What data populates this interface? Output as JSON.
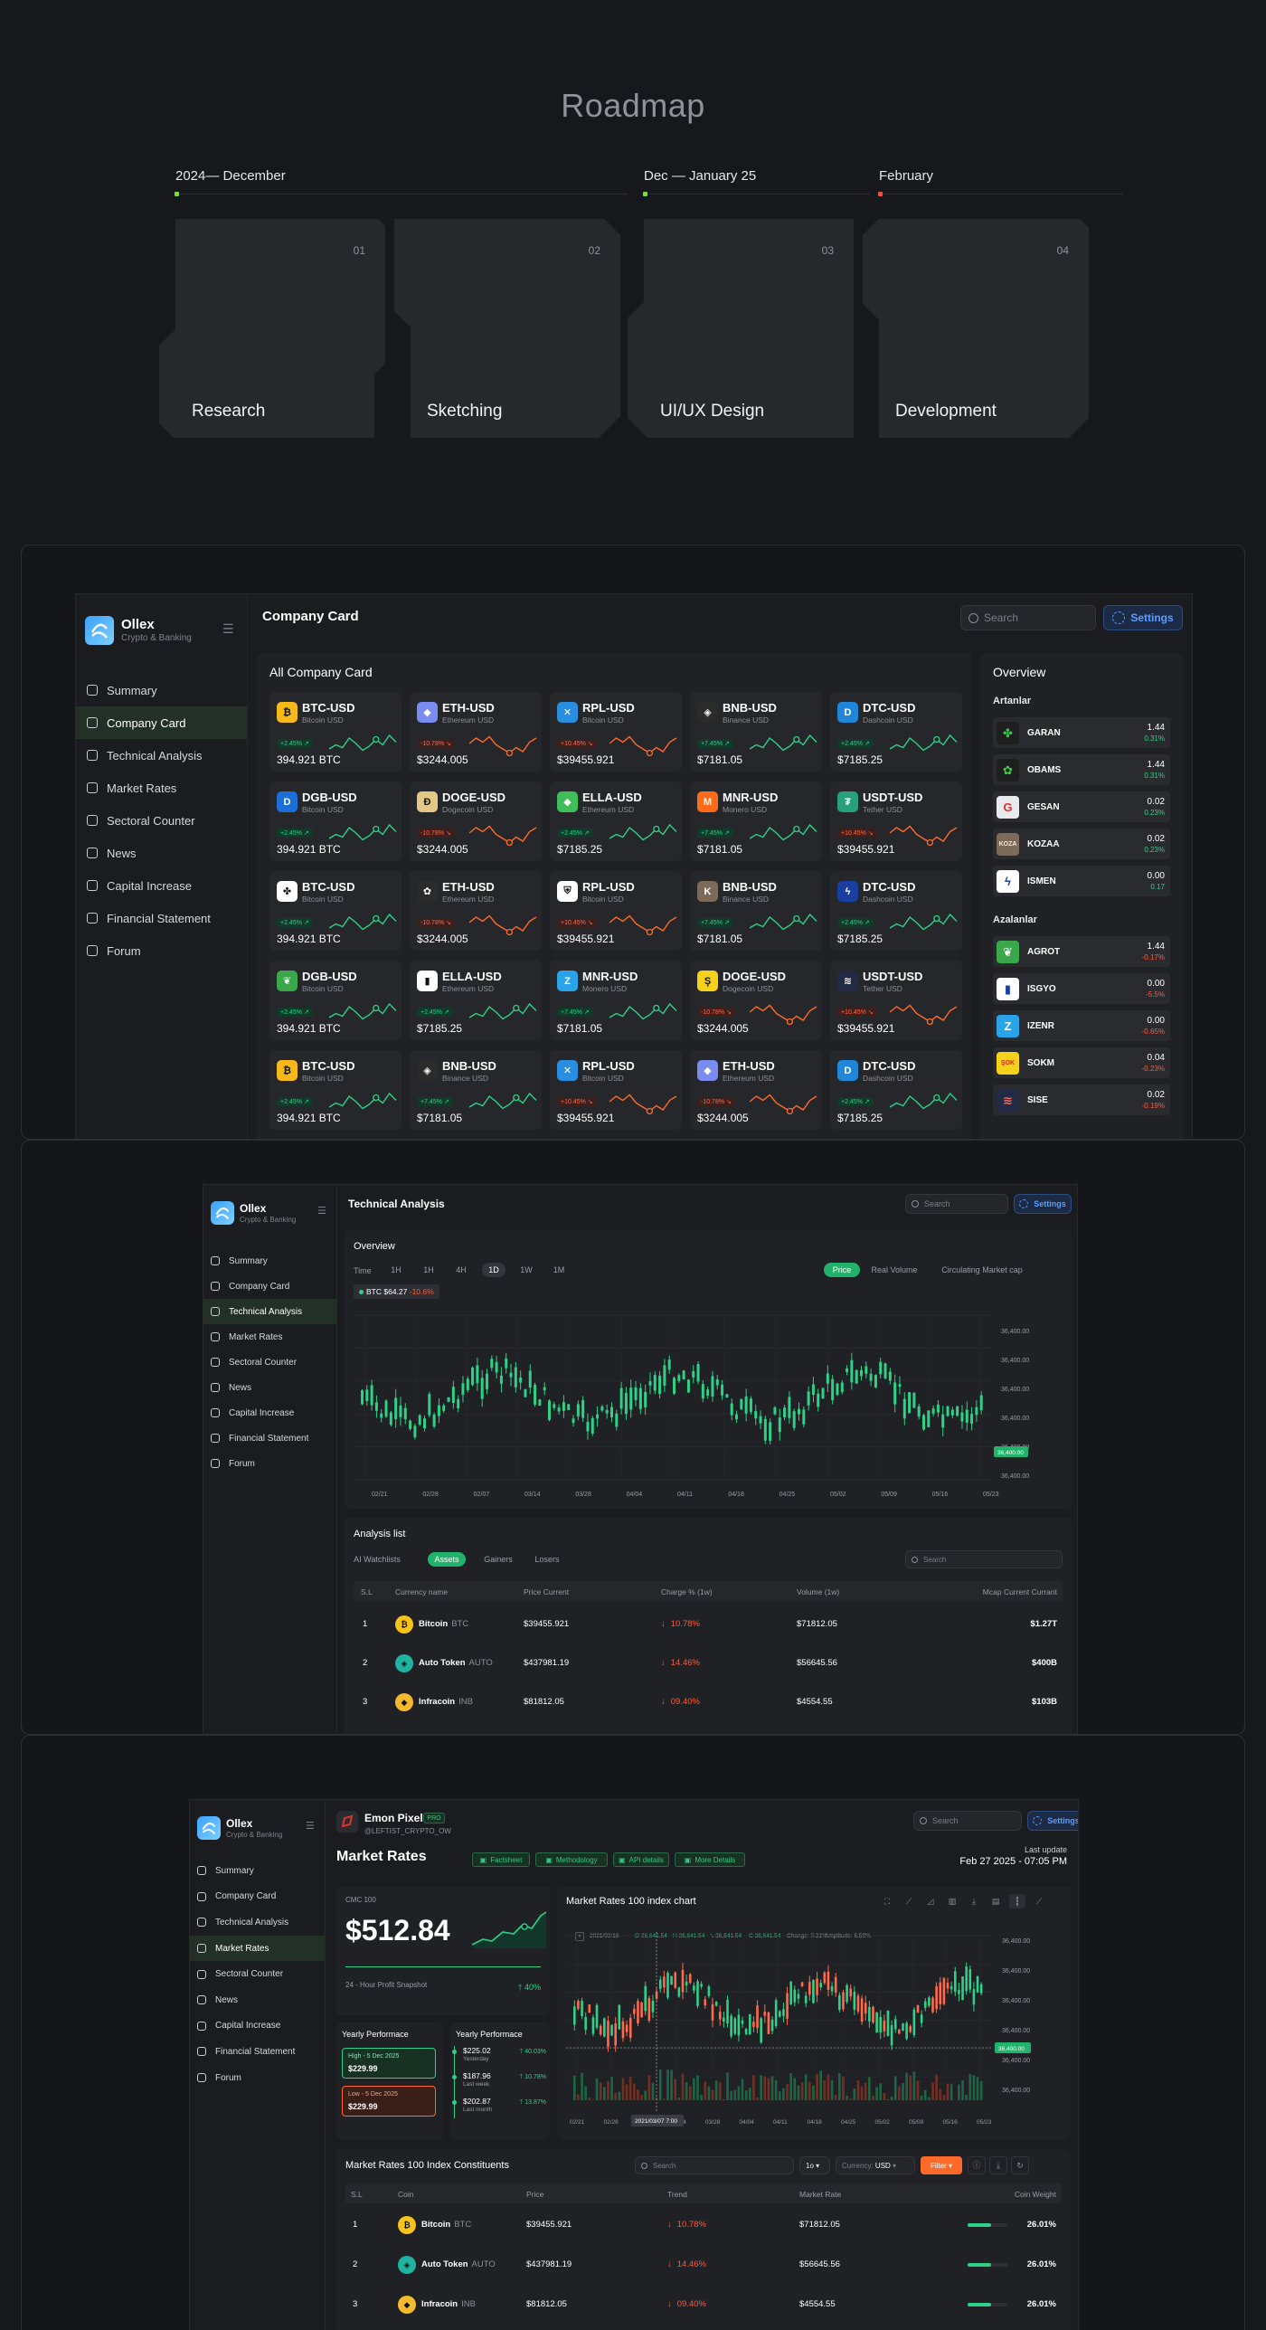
{
  "roadmap": {
    "title": "Roadmap",
    "phases": [
      {
        "label": "2024— December",
        "dot_color": "#7bdc3a"
      },
      {
        "label": "Dec — January 25",
        "dot_color": "#7bdc3a"
      },
      {
        "label": "February",
        "dot_color": "#ff4a3a"
      }
    ],
    "cards": [
      {
        "num": "01",
        "label": "Research"
      },
      {
        "num": "02",
        "label": "Sketching"
      },
      {
        "num": "03",
        "label": "UI/UX Design"
      },
      {
        "num": "04",
        "label": "Development"
      }
    ]
  },
  "brand": {
    "name": "Ollex",
    "tagline": "Crypto & Banking"
  },
  "nav": [
    "Summary",
    "Company Card",
    "Technical Analysis",
    "Market Rates",
    "Sectoral Counter",
    "News",
    "Capital Increase",
    "Financial Statement",
    "Forum"
  ],
  "nav_icons": [
    "summary-icon",
    "company-card-icon",
    "technical-analysis-icon",
    "market-rates-icon",
    "sectoral-counter-icon",
    "news-icon",
    "capital-increase-icon",
    "financial-statement-icon",
    "forum-icon"
  ],
  "search_placeholder": "Search",
  "settings_label": "Settings",
  "screen1": {
    "page_title": "Company Card",
    "section_title": "All Company Card",
    "cards": [
      {
        "name": "BTC-USD",
        "sub": "Bitcoin USD",
        "chg": "+2.45% ↗",
        "price": "394.921 BTC",
        "up": true,
        "icon": "btc-icon",
        "color": "#f7b81a",
        "glyph": "₿"
      },
      {
        "name": "ETH-USD",
        "sub": "Ethereum USD",
        "chg": "-10.78% ↘",
        "price": "$3244.005",
        "up": false,
        "icon": "eth-icon",
        "color": "#7a8cf0",
        "glyph": "◆"
      },
      {
        "name": "RPL-USD",
        "sub": "Bitcoin USD",
        "chg": "+10.45% ↘",
        "price": "$39455.921",
        "up": false,
        "icon": "rpl-icon",
        "color": "#2a8ee0",
        "glyph": "✕"
      },
      {
        "name": "BNB-USD",
        "sub": "Binance USD",
        "chg": "+7.45% ↗",
        "price": "$7181.05",
        "up": true,
        "icon": "bnb-icon",
        "color": "#2b2b2b",
        "glyph": "◈"
      },
      {
        "name": "DTC-USD",
        "sub": "Dashcoin USD",
        "chg": "+2.45% ↗",
        "price": "$7185.25",
        "up": true,
        "icon": "dtc-icon",
        "color": "#1f86d9",
        "glyph": "D"
      },
      {
        "name": "DGB-USD",
        "sub": "Bitcoin USD",
        "chg": "+2.45% ↗",
        "price": "394.921 BTC",
        "up": true,
        "icon": "dgb-icon",
        "color": "#1d6fd8",
        "glyph": "D"
      },
      {
        "name": "DOGE-USD",
        "sub": "Dogecoin USD",
        "chg": "-10.78% ↘",
        "price": "$3244.005",
        "up": false,
        "icon": "doge-icon",
        "color": "#e4c886",
        "glyph": "Ð"
      },
      {
        "name": "ELLA-USD",
        "sub": "Ethereum USD",
        "chg": "+2.45% ↗",
        "price": "$7185.25",
        "up": true,
        "icon": "ella-icon",
        "color": "#3fbf5a",
        "glyph": "◆"
      },
      {
        "name": "MNR-USD",
        "sub": "Monero USD",
        "chg": "+7.45% ↗",
        "price": "$7181.05",
        "up": true,
        "icon": "mnr-icon",
        "color": "#ff6b1a",
        "glyph": "M"
      },
      {
        "name": "USDT-USD",
        "sub": "Tether USD",
        "chg": "+10.45% ↘",
        "price": "$39455.921",
        "up": false,
        "icon": "usdt-icon",
        "color": "#26a17b",
        "glyph": "₮"
      },
      {
        "name": "BTC-USD",
        "sub": "Bitcoin USD",
        "chg": "+2.45% ↗",
        "price": "394.921 BTC",
        "up": true,
        "icon": "clover-icon",
        "color": "#ffffff",
        "glyph": "✤"
      },
      {
        "name": "ETH-USD",
        "sub": "Ethereum USD",
        "chg": "-10.78% ↘",
        "price": "$3244.005",
        "up": false,
        "icon": "flower-icon",
        "color": "#2b2b2b",
        "glyph": "✿"
      },
      {
        "name": "RPL-USD",
        "sub": "Bitcoin USD",
        "chg": "+10.45% ↘",
        "price": "$39455.921",
        "up": false,
        "icon": "shield-icon",
        "color": "#ffffff",
        "glyph": "⛨"
      },
      {
        "name": "BNB-USD",
        "sub": "Binance USD",
        "chg": "+7.45% ↗",
        "price": "$7181.05",
        "up": true,
        "icon": "kozaa-icon",
        "color": "#7d6a58",
        "glyph": "K"
      },
      {
        "name": "DTC-USD",
        "sub": "Dashcoin USD",
        "chg": "+2.45% ↗",
        "price": "$7185.25",
        "up": true,
        "icon": "bolt-icon",
        "color": "#1b3fa0",
        "glyph": "ϟ"
      },
      {
        "name": "DGB-USD",
        "sub": "Bitcoin USD",
        "chg": "+2.45% ↗",
        "price": "394.921 BTC",
        "up": true,
        "icon": "agrot-icon",
        "color": "#3aa84a",
        "glyph": "❦"
      },
      {
        "name": "ELLA-USD",
        "sub": "Ethereum USD",
        "chg": "+2.45% ↗",
        "price": "$7185.25",
        "up": true,
        "icon": "isgyo-icon",
        "color": "#ffffff",
        "glyph": "▮"
      },
      {
        "name": "MNR-USD",
        "sub": "Monero USD",
        "chg": "+7.45% ↗",
        "price": "$7181.05",
        "up": true,
        "icon": "izenr-icon",
        "color": "#2aa4e8",
        "glyph": "Z"
      },
      {
        "name": "DOGE-USD",
        "sub": "Dogecoin USD",
        "chg": "-10.78% ↘",
        "price": "$3244.005",
        "up": false,
        "icon": "sokm-icon",
        "color": "#f7d21a",
        "glyph": "Ş"
      },
      {
        "name": "USDT-USD",
        "sub": "Tether USD",
        "chg": "+10.45% ↘",
        "price": "$39455.921",
        "up": false,
        "icon": "sise-icon",
        "color": "#222a44",
        "glyph": "≋"
      },
      {
        "name": "BTC-USD",
        "sub": "Bitcoin USD",
        "chg": "+2.45% ↗",
        "price": "394.921 BTC",
        "up": true,
        "icon": "btc-icon",
        "color": "#f7b81a",
        "glyph": "₿"
      },
      {
        "name": "BNB-USD",
        "sub": "Binance USD",
        "chg": "+7.45% ↗",
        "price": "$7181.05",
        "up": true,
        "icon": "bnb-icon",
        "color": "#2b2b2b",
        "glyph": "◈"
      },
      {
        "name": "RPL-USD",
        "sub": "Bitcoin USD",
        "chg": "+10.45% ↘",
        "price": "$39455.921",
        "up": false,
        "icon": "rpl-icon",
        "color": "#2a8ee0",
        "glyph": "✕"
      },
      {
        "name": "ETH-USD",
        "sub": "Ethereum USD",
        "chg": "-10.78% ↘",
        "price": "$3244.005",
        "up": false,
        "icon": "eth-icon",
        "color": "#7a8cf0",
        "glyph": "◆"
      },
      {
        "name": "DTC-USD",
        "sub": "Dashcoin USD",
        "chg": "+2.45% ↗",
        "price": "$7185.25",
        "up": true,
        "icon": "dtc-icon",
        "color": "#1f86d9",
        "glyph": "D"
      }
    ],
    "overview": {
      "title": "Overview",
      "gainers_title": "Artanlar",
      "gainers": [
        {
          "name": "GARAN",
          "val": "1.44",
          "chg": "0.31%",
          "color": "#1f1f1f",
          "glyph": "✤",
          "gcolor": "#2fd04a"
        },
        {
          "name": "OBAMS",
          "val": "1.44",
          "chg": "0.31%",
          "color": "#1f1f1f",
          "glyph": "✿",
          "gcolor": "#3ad83a"
        },
        {
          "name": "GESAN",
          "val": "0.02",
          "chg": "0.23%",
          "color": "#e8eaed",
          "glyph": "G",
          "gcolor": "#e0312a"
        },
        {
          "name": "KOZAA",
          "val": "0.02",
          "chg": "0.23%",
          "color": "#7d6a58",
          "glyph": "KOZA",
          "gcolor": "#f3ead8"
        },
        {
          "name": "ISMEN",
          "val": "0.00",
          "chg": "0.17",
          "color": "#ffffff",
          "glyph": "ϟ",
          "gcolor": "#1b3fa0"
        }
      ],
      "losers_title": "Azalanlar",
      "losers": [
        {
          "name": "AGROT",
          "val": "1.44",
          "chg": "-0.17%",
          "color": "#3aa84a",
          "glyph": "❦",
          "gcolor": "#ffffff"
        },
        {
          "name": "ISGYO",
          "val": "0.00",
          "chg": "-5.5%",
          "color": "#ffffff",
          "glyph": "▮",
          "gcolor": "#1b3fa0"
        },
        {
          "name": "IZENR",
          "val": "0.00",
          "chg": "-0.65%",
          "color": "#2aa4e8",
          "glyph": "Z",
          "gcolor": "#ffffff"
        },
        {
          "name": "SOKM",
          "val": "0.04",
          "chg": "-0.23%",
          "color": "#f7d21a",
          "glyph": "ŞOK",
          "gcolor": "#d42a1a"
        },
        {
          "name": "SISE",
          "val": "0.02",
          "chg": "-0.19%",
          "color": "#222a44",
          "glyph": "≋",
          "gcolor": "#ff6a5a"
        }
      ]
    }
  },
  "screen2": {
    "page_title": "Technical Analysis",
    "overview_title": "Overview",
    "time_label": "Time",
    "timeframes": [
      "1H",
      "1H",
      "4H",
      "1D",
      "1W",
      "1M"
    ],
    "active_timeframe": "1D",
    "metrics": [
      "Price",
      "Real Volume",
      "Circulating Market cap"
    ],
    "active_metric": "Price",
    "btc_tag": "BTC $64.27",
    "btc_change": "-10.6%",
    "y_ticks": [
      "36,400.00",
      "36,400.00",
      "36,400.00",
      "36,400.00",
      "36,400.00",
      "36,400.00"
    ],
    "price_marker": "36,400.00",
    "x_ticks": [
      "02/21",
      "02/28",
      "02/07",
      "03/14",
      "03/28",
      "04/04",
      "04/11",
      "04/18",
      "04/25",
      "05/02",
      "05/09",
      "05/16",
      "05/23"
    ],
    "analysis_title": "Analysis list",
    "tabs": [
      "AI Watchlists",
      "Assets",
      "Gainers",
      "Losers"
    ],
    "active_tab": "Assets",
    "columns": [
      "S.L",
      "Currency name",
      "Price Current",
      "Charge % (1w)",
      "Volume (1w)",
      "Mcap Current Currant"
    ],
    "rows": [
      {
        "sl": "1",
        "name": "Bitcoin",
        "ticker": "BTC",
        "price": "$39455.921",
        "chg": "10.78%",
        "vol": "$71812.05",
        "mcap": "$1.27T",
        "color": "#f7c21a",
        "glyph": "₿"
      },
      {
        "sl": "2",
        "name": "Auto Token",
        "ticker": "AUTO",
        "price": "$437981.19",
        "chg": "14.46%",
        "vol": "$56645.56",
        "mcap": "$400B",
        "color": "#1fb3a0",
        "glyph": "◈"
      },
      {
        "sl": "3",
        "name": "Infracoin",
        "ticker": "INB",
        "price": "$81812.05",
        "chg": "09.40%",
        "vol": "$4554.55",
        "mcap": "$103B",
        "color": "#f3ba2f",
        "glyph": "◆"
      }
    ]
  },
  "screen3": {
    "user_name": "Emon Pixel",
    "user_badge": "PRO",
    "user_handle": "@LEFTIST_CRYPTO_OW",
    "page_title": "Market Rates",
    "tags": [
      "Factsheet",
      "Methodology",
      "API details",
      "More Details"
    ],
    "last_update_label": "Last update",
    "last_update": "Feb 27 2025 - 07:05 PM",
    "cmc_label": "CMC 100",
    "cmc_value": "$512.84",
    "snapshot_label": "24 - Hour Profit Snapshot",
    "snapshot_value": "40%",
    "yearly_left_title": "Yearly Performace",
    "high_label": "High - 5 Dec 2025",
    "high_value": "$229.99",
    "low_label": "Low - 5 Dec 2025",
    "low_value": "$229.99",
    "yearly_right_title": "Yearly Performace",
    "yearly_items": [
      {
        "value": "$225.02",
        "label": "Yesterday",
        "chg": "40.03%"
      },
      {
        "value": "$187.96",
        "label": "Last week",
        "chg": "10.78%"
      },
      {
        "value": "$202.87",
        "label": "Last month",
        "chg": "13.87%"
      }
    ],
    "chart_title": "Market Rates 100 index chart",
    "ohlc_date": "2021/03/16",
    "ohlc": [
      "O 36,641.54",
      "H 36,641.54",
      "L 36,641.54",
      "C 36,641.54",
      "Change: 3.31%",
      "Amplitude: 6.59%"
    ],
    "y_ticks": [
      "36,400.00",
      "36,400.00",
      "36,400.00",
      "36,400.00",
      "36,400.00",
      "36,400.00"
    ],
    "price_marker": "36,400.00",
    "x_ticks": [
      "02/21",
      "02/28",
      "02/07",
      "03/14",
      "03/28",
      "04/04",
      "04/11",
      "04/18",
      "04/25",
      "05/02",
      "05/09",
      "05/16",
      "05/23"
    ],
    "crosshair_date": "2021/03/07 7:00",
    "constituents_title": "Market Rates 100 Index Constituents",
    "period": "1o",
    "currency_label": "Currency:",
    "currency": "USD",
    "filter_label": "Filter",
    "columns": [
      "S.L",
      "Coin",
      "Price",
      "Trend",
      "Market Rate",
      "Coin Weight"
    ],
    "rows": [
      {
        "sl": "1",
        "name": "Bitcoin",
        "ticker": "BTC",
        "price": "$39455.921",
        "trend": "10.78%",
        "rate": "$71812.05",
        "weight": "26.01%",
        "color": "#f7c21a",
        "glyph": "₿"
      },
      {
        "sl": "2",
        "name": "Auto Token",
        "ticker": "AUTO",
        "price": "$437981.19",
        "trend": "14.46%",
        "rate": "$56645.56",
        "weight": "26.01%",
        "color": "#1fb3a0",
        "glyph": "◈"
      },
      {
        "sl": "3",
        "name": "Infracoin",
        "ticker": "INB",
        "price": "$81812.05",
        "trend": "09.40%",
        "rate": "$4554.55",
        "weight": "26.01%",
        "color": "#f3ba2f",
        "glyph": "◆"
      }
    ]
  },
  "colors": {
    "green": "#2fd088",
    "red": "#ff5a3c",
    "blue": "#5b9cff",
    "orange": "#ff6a2a"
  }
}
